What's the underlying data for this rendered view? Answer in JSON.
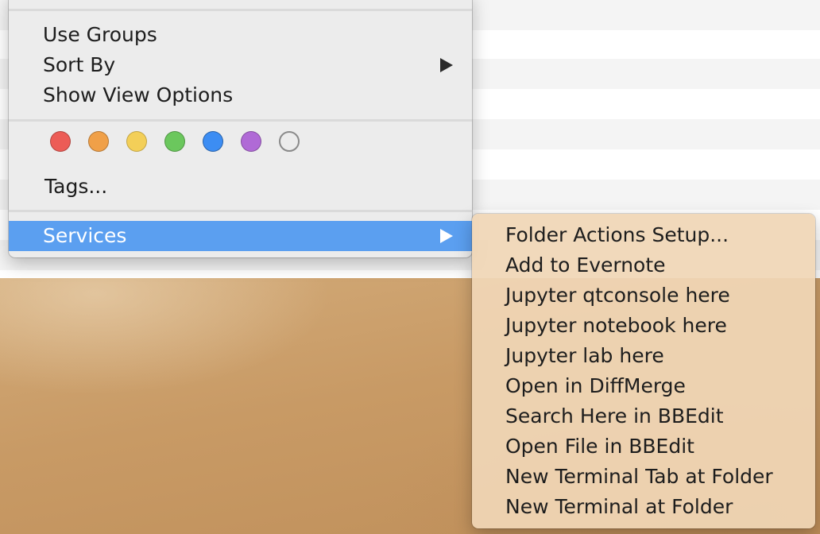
{
  "context_menu": {
    "items": [
      {
        "label": "Use Groups"
      },
      {
        "label": "Sort By"
      },
      {
        "label": "Show View Options"
      }
    ],
    "tags_label": "Tags...",
    "tag_colors": [
      "#ec5c56",
      "#f0a048",
      "#f3cf58",
      "#6bc75d",
      "#3c8df3",
      "#b06ad6",
      "none"
    ],
    "services_label": "Services"
  },
  "services_submenu": {
    "items": [
      {
        "label": "Folder Actions Setup..."
      },
      {
        "label": "Add to Evernote"
      },
      {
        "label": "Jupyter qtconsole here"
      },
      {
        "label": "Jupyter notebook here"
      },
      {
        "label": "Jupyter lab here"
      },
      {
        "label": "Open in DiffMerge"
      },
      {
        "label": "Search Here in BBEdit"
      },
      {
        "label": "Open File in BBEdit"
      },
      {
        "label": "New Terminal Tab at Folder"
      },
      {
        "label": "New Terminal at Folder"
      }
    ]
  },
  "colors": {
    "highlight": "#5b9ff0",
    "menu_bg": "#ececec",
    "submenu_bg": "#f0d6b6"
  }
}
